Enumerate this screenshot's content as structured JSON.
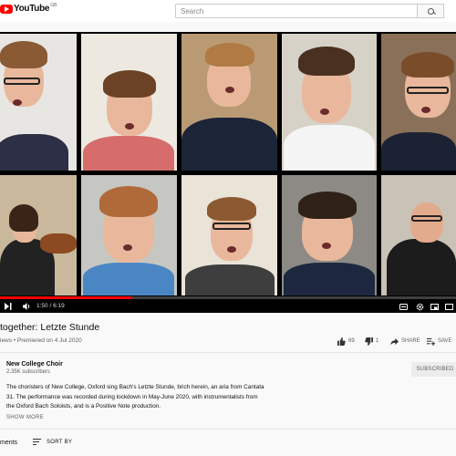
{
  "header": {
    "logo_text": "YouTube",
    "country_code": "GB",
    "search_placeholder": "Search"
  },
  "player": {
    "time_display": "1:50 / 6:19",
    "progress_fraction": 0.29
  },
  "video": {
    "title": "together: Letzte Stunde",
    "meta": "iews • Premiered on 4 Jul 2020",
    "likes": "69",
    "dislikes": "1",
    "share_label": "SHARE",
    "save_label": "SAVE"
  },
  "channel": {
    "name": "New College Choir",
    "subscribers": "2.35K subscribers",
    "subscribe_label": "SUBSCRIBED"
  },
  "description": {
    "line1": "The choristers of New College, Oxford sing Bach's Letzte Stunde, brich herein, an aria from Cantata",
    "line2": "31. The performance was recorded during lockdown in May-June 2020, with instrumentalists from",
    "line3": "the Oxford Bach Soloists, and is a Positive Note production.",
    "show_more": "SHOW MORE"
  },
  "comments": {
    "label": "ments",
    "sort_label": "SORT BY"
  },
  "colors": {
    "brand_red": "#ff0000",
    "text_primary": "#0f0f0f",
    "text_secondary": "#606060"
  }
}
